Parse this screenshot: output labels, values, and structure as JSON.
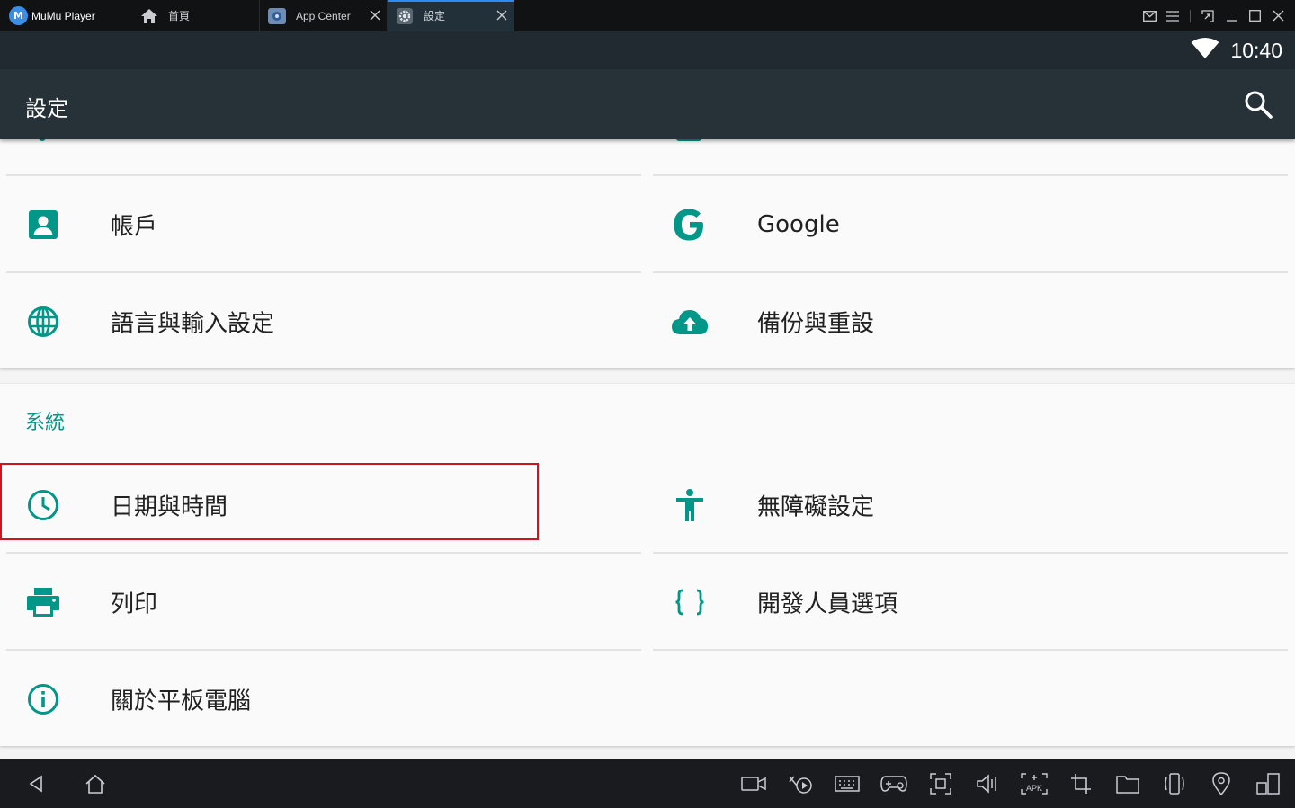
{
  "titlebar": {
    "app_name": "MuMu Player",
    "logo_letter": "M",
    "tabs": [
      {
        "label": "首頁",
        "icon": "home-icon",
        "closable": false
      },
      {
        "label": "App Center",
        "icon": "app-center-icon",
        "closable": true
      },
      {
        "label": "設定",
        "icon": "gear-icon",
        "closable": true,
        "active": true
      }
    ],
    "window_controls": [
      "mail-icon",
      "menu-icon",
      "resize-icon",
      "minimize-icon",
      "maximize-icon",
      "close-icon"
    ]
  },
  "statusbar": {
    "time": "10:40",
    "icons": [
      "wifi-icon"
    ]
  },
  "actionbar": {
    "title": "設定",
    "search_icon": "search-icon"
  },
  "settings": {
    "top_card": [
      {
        "label": "帳戶",
        "icon": "account-icon"
      },
      {
        "label": "Google",
        "icon": "google-icon"
      },
      {
        "label": "語言與輸入設定",
        "icon": "language-icon"
      },
      {
        "label": "備份與重設",
        "icon": "cloud-upload-icon"
      }
    ],
    "system_section": {
      "header": "系統",
      "items": [
        {
          "label": "日期與時間",
          "icon": "clock-icon",
          "highlighted": true
        },
        {
          "label": "無障礙設定",
          "icon": "accessibility-icon"
        },
        {
          "label": "列印",
          "icon": "print-icon"
        },
        {
          "label": "開發人員選項",
          "icon": "developer-braces-icon"
        },
        {
          "label": "關於平板電腦",
          "icon": "info-icon"
        }
      ]
    }
  },
  "bottombar": {
    "left": [
      "back-icon",
      "home-icon"
    ],
    "right": [
      "video-record-icon",
      "macro-icon",
      "keyboard-icon",
      "gamepad-icon",
      "screenshot-icon",
      "volume-icon",
      "apk-install-icon",
      "crop-icon",
      "folder-icon",
      "shake-icon",
      "location-icon",
      "multi-window-icon"
    ],
    "apk_label": "APK"
  },
  "colors": {
    "accent": "#009688",
    "toolbar": "#263238",
    "statusbar": "#202a30",
    "highlight": "#d0141d"
  }
}
